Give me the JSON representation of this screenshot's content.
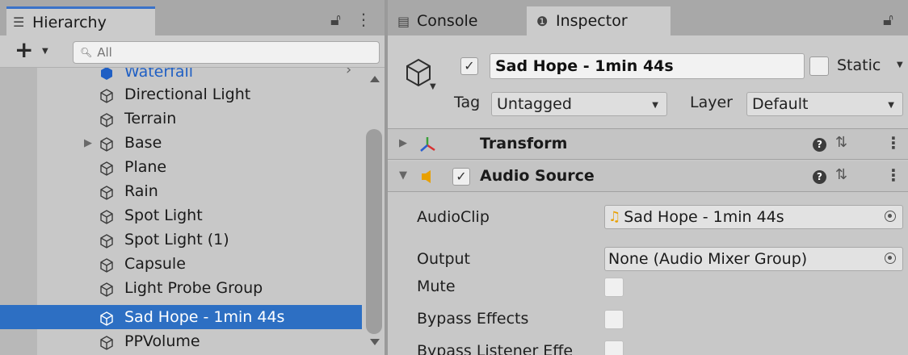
{
  "hierarchy": {
    "tab_label": "Hierarchy",
    "search_placeholder": "All",
    "items": [
      {
        "label": "Waterfall",
        "cut": true
      },
      {
        "label": "Directional Light"
      },
      {
        "label": "Terrain"
      },
      {
        "label": "Base",
        "has_children": true
      },
      {
        "label": "Plane"
      },
      {
        "label": "Rain"
      },
      {
        "label": "Spot Light"
      },
      {
        "label": "Spot Light (1)"
      },
      {
        "label": "Capsule"
      },
      {
        "label": "Light Probe Group"
      },
      {
        "label": "Sad Hope - 1min 44s",
        "selected": true
      },
      {
        "label": "PPVolume"
      }
    ]
  },
  "inspector": {
    "tabs": {
      "console": "Console",
      "inspector": "Inspector"
    },
    "object_name": "Sad Hope - 1min 44s",
    "active": true,
    "static_label": "Static",
    "tag_label": "Tag",
    "tag_value": "Untagged",
    "layer_label": "Layer",
    "layer_value": "Default",
    "components": {
      "transform": {
        "title": "Transform",
        "expanded": false
      },
      "audio_source": {
        "title": "Audio Source",
        "expanded": true,
        "enabled": true
      }
    },
    "properties": {
      "audioclip_label": "AudioClip",
      "audioclip_value": "Sad Hope - 1min 44s",
      "output_label": "Output",
      "output_value": "None (Audio Mixer Group)",
      "mute_label": "Mute",
      "bypass_effects_label": "Bypass Effects",
      "bypass_listener_label": "Bypass Listener Effe"
    }
  },
  "colors": {
    "selection": "#2d6fc3",
    "tab_accent": "#3a72c8",
    "audio_icon": "#e8a000"
  }
}
